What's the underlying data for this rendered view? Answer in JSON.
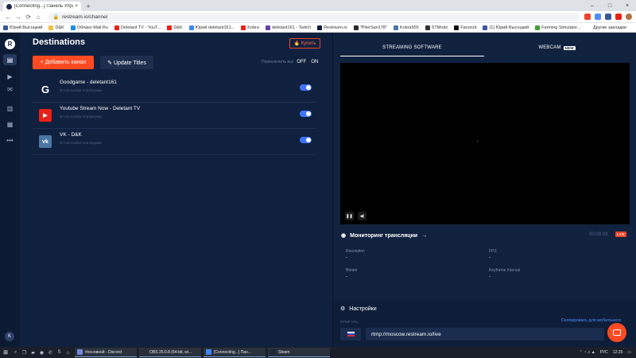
{
  "browser": {
    "tab_title": "[Connecting...] Панель Управ",
    "tab_close": "×",
    "new_tab": "+",
    "window_controls": [
      "–",
      "□",
      "×"
    ],
    "nav": {
      "back": "←",
      "forward": "→",
      "reload": "⟳",
      "home": "⌂"
    },
    "lock": "🔒",
    "url": "restream.io/channel",
    "bookmarks": [
      {
        "label": "Юрий Высоцкий",
        "color": "#3b5998"
      },
      {
        "label": "D&K",
        "color": "#f0c040"
      },
      {
        "label": "Облако Mail.Ru",
        "color": "#168de2"
      },
      {
        "label": "Deletant TV - YouT...",
        "color": "#e62117"
      },
      {
        "label": "D&K",
        "color": "#e62117"
      },
      {
        "label": "Юрий deletant161...",
        "color": "#4285f4"
      },
      {
        "label": "Kobra",
        "color": "#e62117"
      },
      {
        "label": "deletant161 - Twitch",
        "color": "#6441a5"
      },
      {
        "label": "Restream.io",
        "color": "#0f1f3a"
      },
      {
        "label": "\"PiterSan178\"",
        "color": "#2a2a2a"
      },
      {
        "label": "Kobra555",
        "color": "#4c75a3"
      },
      {
        "label": "STModz",
        "color": "#333333"
      },
      {
        "label": "Farozod",
        "color": "#111111"
      },
      {
        "label": "(1) Юрий Высоцкий",
        "color": "#3b5998"
      },
      {
        "label": "Farming Simulator...",
        "color": "#4a9a3f"
      }
    ],
    "bookmarks_other": "Другие закладки"
  },
  "app": {
    "rail_logo": "R",
    "rail_items": [
      {
        "name": "rail-destinations",
        "glyph": "▤",
        "active": true
      },
      {
        "name": "rail-video",
        "glyph": "▶",
        "active": false
      },
      {
        "name": "rail-chat",
        "glyph": "✉",
        "active": false
      },
      {
        "name": "rail-analytics",
        "glyph": "▥",
        "active": false
      },
      {
        "name": "rail-calendar",
        "glyph": "▦",
        "active": false
      },
      {
        "name": "rail-more",
        "glyph": "•••",
        "active": false
      }
    ],
    "rail_gift": "✚",
    "rail_avatar": "K",
    "destinations": {
      "title": "Destinations",
      "buy_label": "🔥 Купить",
      "add_label": "+ Добавить канал",
      "update_label": "✎ Update Titles",
      "toggle_all_label": "Переключить все",
      "toggle_off": "OFF",
      "toggle_on": "ON",
      "channels": [
        {
          "name": "Goodgame - deletant161",
          "sub": "⚙ Настройки платформы",
          "icon": "G",
          "icon_color": "#ffffff",
          "icon_bg": "transparent",
          "enabled": true
        },
        {
          "name": "Youtube Stream Now - Deletant TV",
          "sub": "⚙ Настройки платформы",
          "icon": "▶",
          "icon_color": "#ffffff",
          "icon_bg": "#e62117",
          "enabled": true
        },
        {
          "name": "VK - D&K",
          "sub": "⚙ Настройки платформы",
          "icon": "vk",
          "icon_color": "#ffffff",
          "icon_bg": "#4c75a3",
          "enabled": true
        }
      ]
    },
    "right": {
      "tab_streaming": "STREAMING SOFTWARE",
      "tab_webcam": "WEBCAM",
      "new_badge": "NEW",
      "preview_pause": "❚❚",
      "preview_volume": "◀)",
      "monitoring_title": "Мониторинг трансляции",
      "monitoring_arrow": "→",
      "monitoring_icon": "◉",
      "timer": "00:00:03",
      "live": "LIVE",
      "metrics": {
        "resolution_label": "Resolution",
        "resolution_value": "-",
        "fps_label": "FPS",
        "fps_value": "-",
        "bitrate_label": "Bitrate",
        "bitrate_value": "-",
        "keyframe_label": "Keyframe Interval",
        "keyframe_value": "-"
      },
      "settings_title": "Настройки",
      "settings_icon": "⚙",
      "rtmp_label": "RTMP URL",
      "copy_link": "Скопировать для мобильного",
      "rtmp_url": "rtmp://moscow.restream.io/live"
    }
  },
  "taskbar": {
    "start": "⊞",
    "apps": [
      {
        "label": "#основной - Discord",
        "color": "#7289da"
      },
      {
        "label": "OBS 25.0.8 (64-bit, wi...",
        "color": "#302e31"
      },
      {
        "label": "[Connecting...] Пан...",
        "color": "#4285f4"
      },
      {
        "label": "Steam",
        "color": "#1b2838"
      }
    ],
    "tray_lang": "РУС",
    "tray_time": "12:29"
  }
}
